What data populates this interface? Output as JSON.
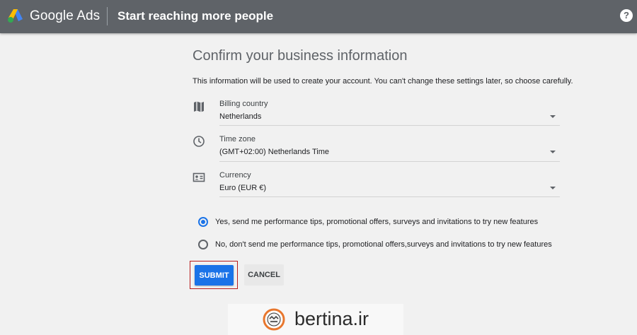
{
  "header": {
    "brand": "Google Ads",
    "title": "Start reaching more people",
    "help_glyph": "?"
  },
  "main": {
    "heading": "Confirm your business information",
    "description": "This information will be used to create your account. You can't change these settings later, so choose carefully.",
    "fields": [
      {
        "icon": "map-icon",
        "label": "Billing country",
        "value": "Netherlands"
      },
      {
        "icon": "clock-icon",
        "label": "Time zone",
        "value": "(GMT+02:00) Netherlands Time"
      },
      {
        "icon": "currency-icon",
        "label": "Currency",
        "value": "Euro (EUR €)"
      }
    ],
    "radios": [
      {
        "label": "Yes, send me performance tips, promotional offers, surveys and invitations to try new features",
        "checked": true
      },
      {
        "label": "No, don't send me performance tips, promotional offers,surveys and invitations to try new features",
        "checked": false
      }
    ],
    "submit_label": "SUBMIT",
    "cancel_label": "CANCEL"
  },
  "watermark": {
    "text": "bertina.ir"
  },
  "colors": {
    "header_bg": "#5f6368",
    "accent": "#1a73e8",
    "highlight_border": "#b71c1c"
  }
}
